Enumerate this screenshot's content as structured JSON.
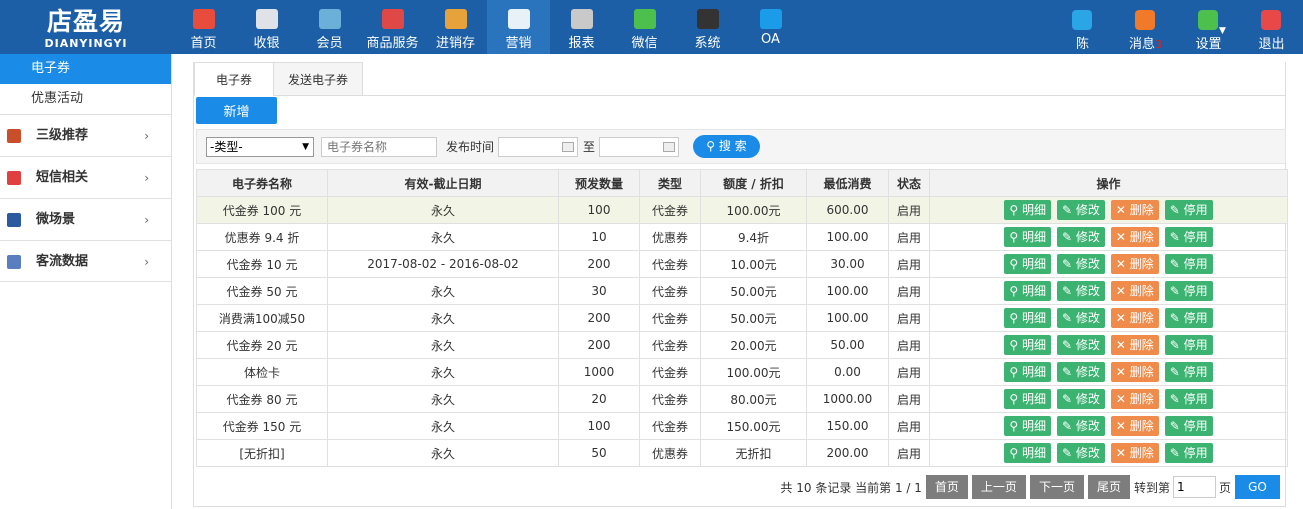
{
  "logo": {
    "cn": "店盈易",
    "en": "DIANYINGYI"
  },
  "nav": [
    {
      "label": "首页",
      "icon": "home-icon",
      "color": "#e74c3c"
    },
    {
      "label": "收银",
      "icon": "cash-register-icon",
      "color": "#dfe3e8"
    },
    {
      "label": "会员",
      "icon": "member-icon",
      "color": "#6ab0d8"
    },
    {
      "label": "商品服务",
      "icon": "goods-icon",
      "color": "#e04848"
    },
    {
      "label": "进销存",
      "icon": "inventory-icon",
      "color": "#e7a23c"
    },
    {
      "label": "营销",
      "icon": "megaphone-icon",
      "color": "#e8f0f8"
    },
    {
      "label": "报表",
      "icon": "report-icon",
      "color": "#c9c9c9"
    },
    {
      "label": "微信",
      "icon": "wechat-icon",
      "color": "#4cbf4c"
    },
    {
      "label": "系统",
      "icon": "system-monitor-icon",
      "color": "#333333"
    },
    {
      "label": "OA",
      "icon": "oa-icon",
      "color": "#1a9ce8"
    }
  ],
  "nav_right": [
    {
      "label": "陈",
      "icon": "user-icon",
      "color": "#2aa5e6"
    },
    {
      "label": "消息",
      "badge": "3",
      "icon": "bell-icon",
      "color": "#f07a2a"
    },
    {
      "label": "设置",
      "icon": "gear-icon",
      "color": "#4cbf4c"
    },
    {
      "label": "退出",
      "icon": "logout-icon",
      "color": "#e84848"
    }
  ],
  "sidebar": {
    "sub_items": [
      "电子券",
      "优惠活动"
    ],
    "groups": [
      {
        "label": "三级推荐",
        "icon": "layers-icon",
        "color": "#c94f2a"
      },
      {
        "label": "短信相关",
        "icon": "phone-icon",
        "color": "#e04040"
      },
      {
        "label": "微场景",
        "icon": "mobile-icon",
        "color": "#2b5aa0"
      },
      {
        "label": "客流数据",
        "icon": "data-icon",
        "color": "#5a7fc0"
      }
    ],
    "chevron": "›"
  },
  "tabs": [
    "电子券",
    "发送电子券"
  ],
  "add_button": "新增",
  "filter": {
    "type_select": "-类型-",
    "name_placeholder": "电子券名称",
    "date_label": "发布时间",
    "to_label": "至",
    "search_button": "搜 索"
  },
  "table": {
    "columns": [
      "电子券名称",
      "有效-截止日期",
      "预发数量",
      "类型",
      "额度 / 折扣",
      "最低消费",
      "状态",
      "操作"
    ],
    "rows": [
      [
        "代金券 100 元",
        "永久",
        "100",
        "代金券",
        "100.00元",
        "600.00",
        "启用"
      ],
      [
        "优惠券 9.4 折",
        "永久",
        "10",
        "优惠券",
        "9.4折",
        "100.00",
        "启用"
      ],
      [
        "代金券 10 元",
        "2017-08-02 - 2016-08-02",
        "200",
        "代金券",
        "10.00元",
        "30.00",
        "启用"
      ],
      [
        "代金券 50 元",
        "永久",
        "30",
        "代金券",
        "50.00元",
        "100.00",
        "启用"
      ],
      [
        "消费满100减50",
        "永久",
        "200",
        "代金券",
        "50.00元",
        "100.00",
        "启用"
      ],
      [
        "代金券 20 元",
        "永久",
        "200",
        "代金券",
        "20.00元",
        "50.00",
        "启用"
      ],
      [
        "体检卡",
        "永久",
        "1000",
        "代金券",
        "100.00元",
        "0.00",
        "启用"
      ],
      [
        "代金券 80 元",
        "永久",
        "20",
        "代金券",
        "80.00元",
        "1000.00",
        "启用"
      ],
      [
        "代金券 150 元",
        "永久",
        "100",
        "代金券",
        "150.00元",
        "150.00",
        "启用"
      ],
      [
        "[无折扣]",
        "永久",
        "50",
        "优惠券",
        "无折扣",
        "200.00",
        "启用"
      ]
    ],
    "actions": [
      "明细",
      "修改",
      "删除",
      "停用"
    ]
  },
  "pager": {
    "summary": "共 10 条记录 当前第 1 / 1",
    "first": "首页",
    "prev": "上一页",
    "next": "下一页",
    "last": "尾页",
    "goto_label": "转到第",
    "page_value": "1",
    "page_suffix": "页",
    "go": "GO"
  }
}
